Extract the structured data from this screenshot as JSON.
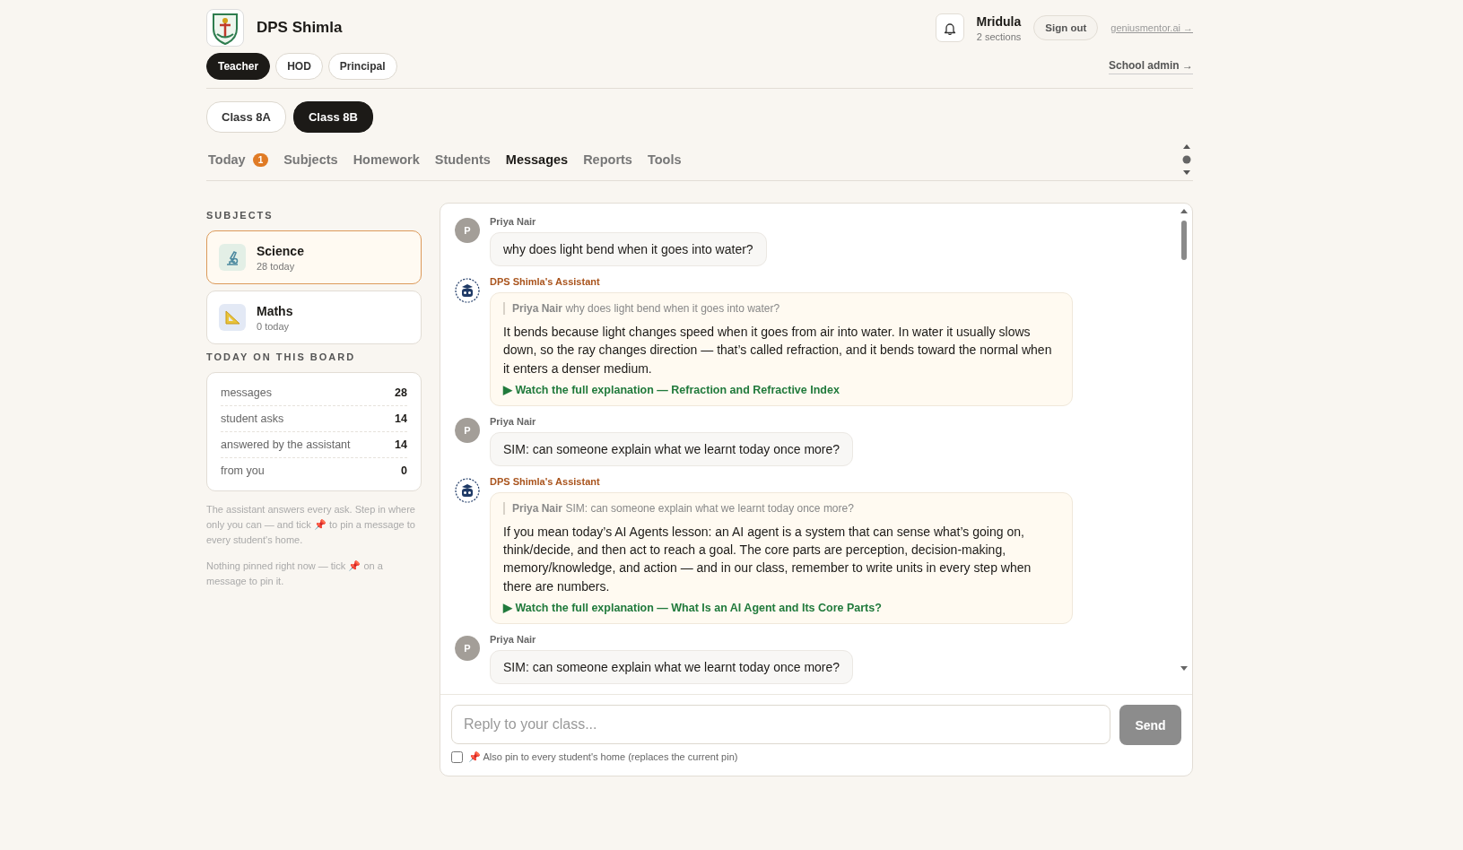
{
  "school": {
    "name": "DPS Shimla"
  },
  "user": {
    "name": "Mridula",
    "detail": "2 sections"
  },
  "sign_out": "Sign out",
  "external_link": "geniusmentor.ai →",
  "roles": [
    {
      "label": "Teacher",
      "selected": true
    },
    {
      "label": "HOD",
      "selected": false
    },
    {
      "label": "Principal",
      "selected": false
    }
  ],
  "admin_link": "School admin →",
  "classes": [
    {
      "label": "Class 8A",
      "selected": false
    },
    {
      "label": "Class 8B",
      "selected": true
    }
  ],
  "tabs": [
    {
      "label": "Today",
      "badge": "1",
      "selected": false
    },
    {
      "label": "Subjects",
      "selected": false
    },
    {
      "label": "Homework",
      "selected": false
    },
    {
      "label": "Students",
      "selected": false
    },
    {
      "label": "Messages",
      "selected": true
    },
    {
      "label": "Reports",
      "selected": false
    },
    {
      "label": "Tools",
      "selected": false
    }
  ],
  "sidebar": {
    "subjects_heading": "SUBJECTS",
    "subjects": [
      {
        "kind": "science",
        "name": "Science",
        "count": "28 today",
        "selected": true
      },
      {
        "kind": "maths",
        "name": "Maths",
        "count": "0 today",
        "selected": false
      }
    ],
    "board_heading": "TODAY ON THIS BOARD",
    "stats": [
      {
        "label": "messages",
        "value": "28"
      },
      {
        "label": "student asks",
        "value": "14"
      },
      {
        "label": "answered by the assistant",
        "value": "14"
      },
      {
        "label": "from you",
        "value": "0"
      }
    ],
    "notes": [
      "The assistant answers every ask. Step in where only you can — and tick 📌 to pin a message to every student's home.",
      "Nothing pinned right now — tick 📌 on a message to pin it."
    ]
  },
  "messages": [
    {
      "kind": "student",
      "author": "Priya Nair",
      "avatar": "P",
      "text": "why does light bend when it goes into water?"
    },
    {
      "kind": "assistant",
      "author": "DPS Shimla's Assistant",
      "quote": "**Priya Nair** why does light bend when it goes into water?",
      "text": "It bends because light changes speed when it goes from air into water. In water it usually slows down, so the ray changes direction — that’s called refraction, and it bends toward the normal when it enters a denser medium.",
      "link": "▶ Watch the full explanation — Refraction and Refractive Index"
    },
    {
      "kind": "student",
      "author": "Priya Nair",
      "avatar": "P",
      "text": "SIM: can someone explain what we learnt today once more?"
    },
    {
      "kind": "assistant",
      "author": "DPS Shimla's Assistant",
      "quote": "**Priya Nair** SIM: can someone explain what we learnt today once more?",
      "text": "If you mean today’s AI Agents lesson: an AI agent is a system that can sense what’s going on, think/decide, and then act to reach a goal. The core parts are perception, decision-making, memory/knowledge, and action — and in our class, remember to write units in every step when there are numbers.",
      "link": "▶ Watch the full explanation — What Is an AI Agent and Its Core Parts?"
    },
    {
      "kind": "student",
      "author": "Priya Nair",
      "avatar": "P",
      "text": "SIM: can someone explain what we learnt today once more?"
    }
  ],
  "composer": {
    "placeholder": "Reply to your class...",
    "send": "Send",
    "pin_option": {
      "label": "📌 Also pin to every student's home (replaces the current pin)",
      "checked": false
    }
  }
}
